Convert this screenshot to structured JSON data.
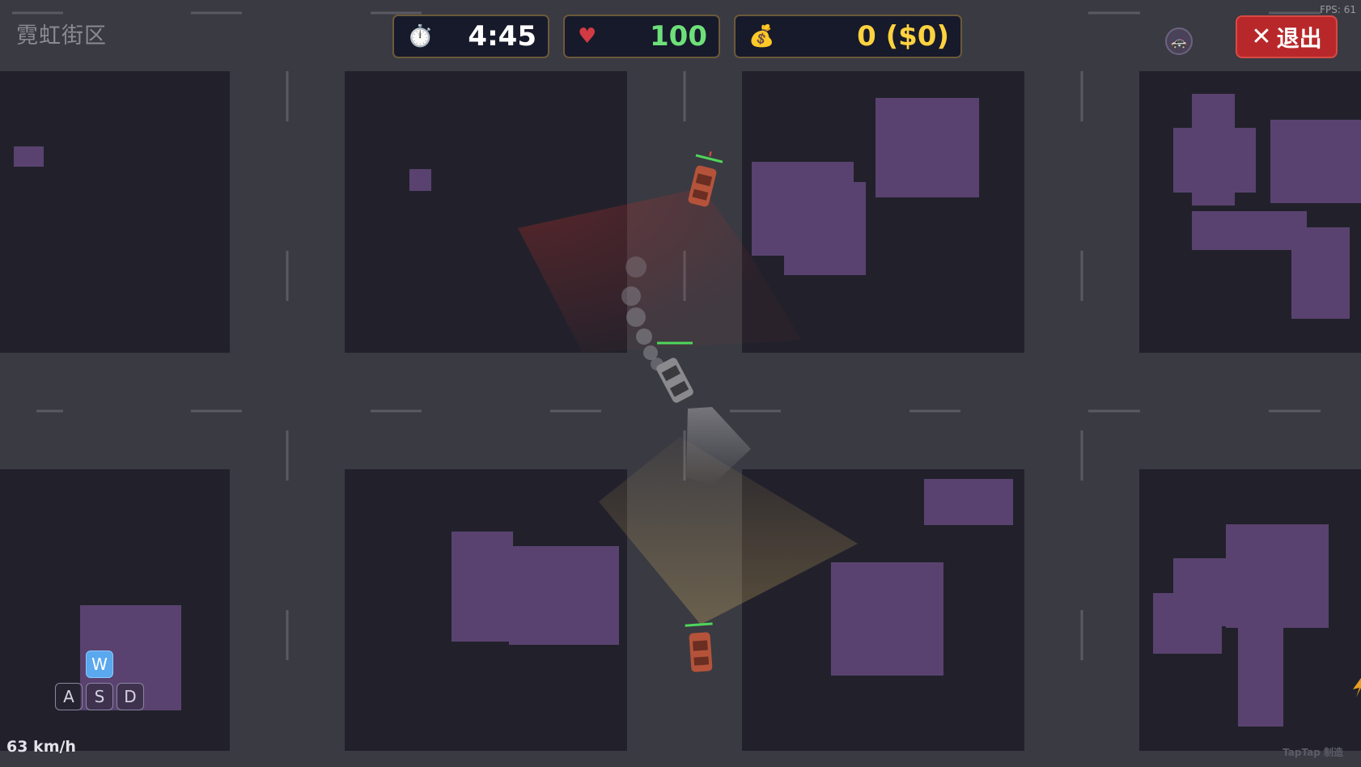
{
  "zone": {
    "name": "霓虹街区"
  },
  "hud": {
    "timer": {
      "icon": "stopwatch-icon",
      "value": "4:45"
    },
    "health": {
      "icon": "heart-icon",
      "value": "100"
    },
    "money": {
      "icon": "money-bag-icon",
      "value": "0 ($0)"
    }
  },
  "fps_label": "FPS: 61",
  "wanted_icon": "police-badge-icon",
  "exit_button": {
    "icon": "close-icon",
    "label": "退出"
  },
  "controls": {
    "keys": [
      "W",
      "A",
      "S",
      "D"
    ],
    "active_key": "W"
  },
  "speed": "63 km/h",
  "watermark": "TapTap 制造",
  "colors": {
    "road": "#3a3a42",
    "block": "#22212b",
    "building": "#59426f",
    "hud_panel": "#171a2b",
    "health": "#6ee07a",
    "money": "#ffd23f",
    "exit": "#b8282a",
    "police_car": "#b5533a",
    "player_car": "#8a8a8e"
  }
}
